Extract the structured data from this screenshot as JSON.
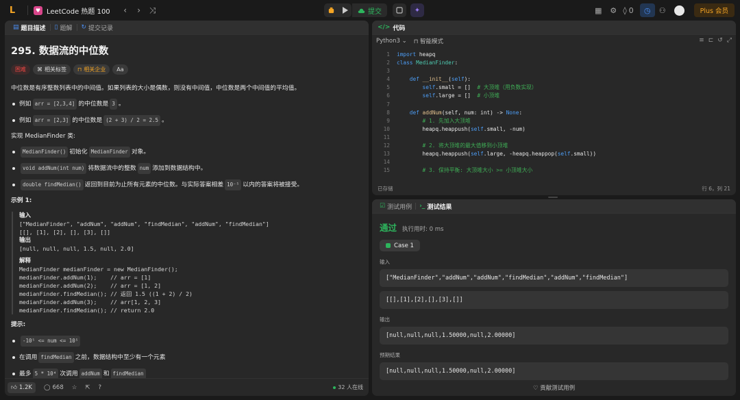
{
  "topbar": {
    "logo": "L",
    "list_badge": "♥",
    "list_title": "LeetCode 热题 100",
    "prev": "‹",
    "next": "›",
    "shuffle": "⤨",
    "submit_label": "提交",
    "streak_count": "0",
    "plus_label": "Plus 会员"
  },
  "left": {
    "tabs": [
      {
        "icon": "▤",
        "label": "题目描述"
      },
      {
        "icon": "▯",
        "label": "题解"
      },
      {
        "icon": "↻",
        "label": "提交记录"
      }
    ],
    "title": "295. 数据流的中位数",
    "tags": {
      "difficulty": "困难",
      "related_tags": "相关标签",
      "companies": "相关企业",
      "font": "Aa"
    },
    "intro": "中位数是有序整数列表中的中间值。如果列表的大小是偶数，则没有中间值，中位数是两个中间值的平均值。",
    "ex1": {
      "pre": "例如",
      "code1": "arr = [2,3,4]",
      "mid": "的中位数是",
      "code2": "3",
      "post": "。"
    },
    "ex2": {
      "pre": "例如",
      "code1": "arr = [2,3]",
      "mid": "的中位数是",
      "code2": "(2 + 3) / 2 = 2.5",
      "post": "。"
    },
    "impl": "实现 MedianFinder 类:",
    "m1": {
      "code": "MedianFinder()",
      "text1": "初始化",
      "code2": "MedianFinder",
      "text2": "对象。"
    },
    "m2": {
      "code": "void addNum(int num)",
      "text1": "将数据流中的整数",
      "code2": "num",
      "text2": "添加到数据结构中。"
    },
    "m3": {
      "code": "double findMedian()",
      "text1": "返回到目前为止所有元素的中位数。与实际答案相差",
      "code2": "10⁻⁵",
      "text2": "以内的答案将被接受。"
    },
    "example_title": "示例 1:",
    "example": {
      "input_label": "输入",
      "input_1": "[\"MedianFinder\", \"addNum\", \"addNum\", \"findMedian\", \"addNum\", \"findMedian\"]",
      "input_2": "[[], [1], [2], [], [3], []]",
      "output_label": "输出",
      "output": "[null, null, null, 1.5, null, 2.0]",
      "explain_label": "解释",
      "explain": [
        "MedianFinder medianFinder = new MedianFinder();",
        "medianFinder.addNum(1);    // arr = [1]",
        "medianFinder.addNum(2);    // arr = [1, 2]",
        "medianFinder.findMedian(); // 返回 1.5 ((1 + 2) / 2)",
        "medianFinder.addNum(3);    // arr[1, 2, 3]",
        "medianFinder.findMedian(); // return 2.0"
      ]
    },
    "hints_title": "提示:",
    "h1": {
      "code": "-10⁵ <= num <= 10⁵"
    },
    "h2": {
      "text1": "在调用",
      "code": "findMedian",
      "text2": "之前，数据结构中至少有一个元素"
    },
    "h3": {
      "text1": "最多",
      "code": "5 * 10⁴",
      "text2": "次调用",
      "code2": "addNum",
      "text3": "和",
      "code3": "findMedian"
    },
    "bottom": {
      "likes": "1.2K",
      "comments": "668",
      "online": "32 人在线"
    }
  },
  "code": {
    "title": "代码",
    "language": "Python3",
    "mode": "智能模式",
    "status_left": "已存储",
    "status_right": "行 6，列 21",
    "lines": [
      {
        "n": "1",
        "segs": [
          {
            "t": "import",
            "c": "kw"
          },
          {
            "t": " heapq",
            "c": ""
          }
        ]
      },
      {
        "n": "2",
        "segs": [
          {
            "t": "class",
            "c": "kw"
          },
          {
            "t": " MedianFinder",
            "c": "cls"
          },
          {
            "t": ":",
            "c": ""
          }
        ]
      },
      {
        "n": "3",
        "segs": []
      },
      {
        "n": "4",
        "segs": [
          {
            "t": "    def",
            "c": "kw"
          },
          {
            "t": " __init__",
            "c": "fn"
          },
          {
            "t": "(",
            "c": ""
          },
          {
            "t": "self",
            "c": "kw"
          },
          {
            "t": "):",
            "c": ""
          }
        ]
      },
      {
        "n": "5",
        "segs": [
          {
            "t": "        self",
            "c": "kw"
          },
          {
            "t": ".small = []  ",
            "c": ""
          },
          {
            "t": "# 大顶堆（用负数实现）",
            "c": "cm"
          }
        ]
      },
      {
        "n": "6",
        "segs": [
          {
            "t": "        self",
            "c": "kw"
          },
          {
            "t": ".large = []  ",
            "c": ""
          },
          {
            "t": "# 小顶堆",
            "c": "cm"
          }
        ]
      },
      {
        "n": "7",
        "segs": []
      },
      {
        "n": "8",
        "segs": [
          {
            "t": "    def",
            "c": "kw"
          },
          {
            "t": " addNum",
            "c": "fn"
          },
          {
            "t": "(self, num: int) -> ",
            "c": ""
          },
          {
            "t": "None",
            "c": "kw"
          },
          {
            "t": ":",
            "c": ""
          }
        ]
      },
      {
        "n": "9",
        "segs": [
          {
            "t": "        # 1. 先加入大顶堆",
            "c": "cm"
          }
        ]
      },
      {
        "n": "10",
        "segs": [
          {
            "t": "        heapq.heappush(",
            "c": ""
          },
          {
            "t": "self",
            "c": "kw"
          },
          {
            "t": ".small, -num)",
            "c": ""
          }
        ]
      },
      {
        "n": "11",
        "segs": []
      },
      {
        "n": "12",
        "segs": [
          {
            "t": "        # 2. 将大顶堆的最大值移到小顶堆",
            "c": "cm"
          }
        ]
      },
      {
        "n": "13",
        "segs": [
          {
            "t": "        heapq.heappush(",
            "c": ""
          },
          {
            "t": "self",
            "c": "kw"
          },
          {
            "t": ".large, -heapq.heappop(",
            "c": ""
          },
          {
            "t": "self",
            "c": "kw"
          },
          {
            "t": ".small))",
            "c": ""
          }
        ]
      },
      {
        "n": "14",
        "segs": []
      },
      {
        "n": "15",
        "segs": [
          {
            "t": "        # 3. 保持平衡: 大顶堆大小 >= 小顶堆大小",
            "c": "cm"
          }
        ]
      }
    ]
  },
  "result": {
    "tab_testcase": "测试用例",
    "tab_result": "测试结果",
    "verdict": "通过",
    "runtime": "执行用时: 0 ms",
    "case_label": "Case 1",
    "input_label": "输入",
    "input_1": "[\"MedianFinder\",\"addNum\",\"addNum\",\"findMedian\",\"addNum\",\"findMedian\"]",
    "input_2": "[[],[1],[2],[],[3],[]]",
    "output_label": "输出",
    "output": "[null,null,null,1.50000,null,2.00000]",
    "expected_label": "预期结果",
    "expected": "[null,null,null,1.50000,null,2.00000]",
    "contribute": "贡献测试用例"
  }
}
